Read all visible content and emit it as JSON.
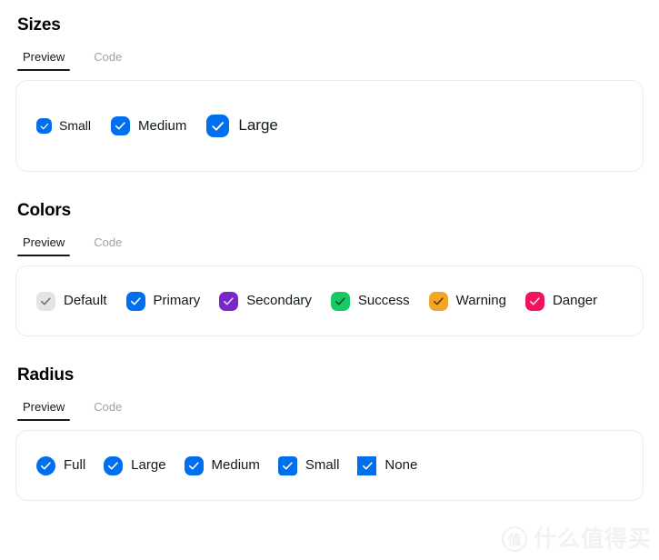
{
  "colors": {
    "default": "#e4e4e7",
    "default_check": "#71717a",
    "primary": "#006FEE",
    "primary_check": "#ffffff",
    "secondary": "#7828c8",
    "secondary_check": "#e9d5ff",
    "success": "#17c964",
    "success_check": "#0b4a28",
    "warning": "#f5a524",
    "warning_check": "#5a3a06",
    "danger": "#f31260",
    "danger_check": "#ffd6e4",
    "tab_active": "#18181b",
    "tab_inactive": "#a1a1aa",
    "card_border": "#ededf0",
    "label": "#11181c"
  },
  "sections": [
    {
      "title": "Sizes",
      "tabs": [
        {
          "label": "Preview",
          "active": true
        },
        {
          "label": "Code",
          "active": false
        }
      ],
      "items": [
        {
          "label": "Small",
          "size": "sm",
          "color": "primary",
          "checked": true
        },
        {
          "label": "Medium",
          "size": "md",
          "color": "primary",
          "checked": true
        },
        {
          "label": "Large",
          "size": "lg",
          "color": "primary",
          "checked": true
        }
      ]
    },
    {
      "title": "Colors",
      "tabs": [
        {
          "label": "Preview",
          "active": true
        },
        {
          "label": "Code",
          "active": false
        }
      ],
      "items": [
        {
          "label": "Default",
          "size": "md",
          "color": "default",
          "checked": true
        },
        {
          "label": "Primary",
          "size": "md",
          "color": "primary",
          "checked": true
        },
        {
          "label": "Secondary",
          "size": "md",
          "color": "secondary",
          "checked": true
        },
        {
          "label": "Success",
          "size": "md",
          "color": "success",
          "checked": true
        },
        {
          "label": "Warning",
          "size": "md",
          "color": "warning",
          "checked": true
        },
        {
          "label": "Danger",
          "size": "md",
          "color": "danger",
          "checked": true
        }
      ]
    },
    {
      "title": "Radius",
      "tabs": [
        {
          "label": "Preview",
          "active": true
        },
        {
          "label": "Code",
          "active": false
        }
      ],
      "items": [
        {
          "label": "Full",
          "size": "md",
          "color": "primary",
          "radius": "full",
          "checked": true
        },
        {
          "label": "Large",
          "size": "md",
          "color": "primary",
          "radius": "large",
          "checked": true
        },
        {
          "label": "Medium",
          "size": "md",
          "color": "primary",
          "radius": "medium",
          "checked": true
        },
        {
          "label": "Small",
          "size": "md",
          "color": "primary",
          "radius": "small",
          "checked": true
        },
        {
          "label": "None",
          "size": "md",
          "color": "primary",
          "radius": "none",
          "checked": true
        }
      ]
    }
  ],
  "watermark": {
    "badge": "值",
    "text": "什么值得买"
  }
}
